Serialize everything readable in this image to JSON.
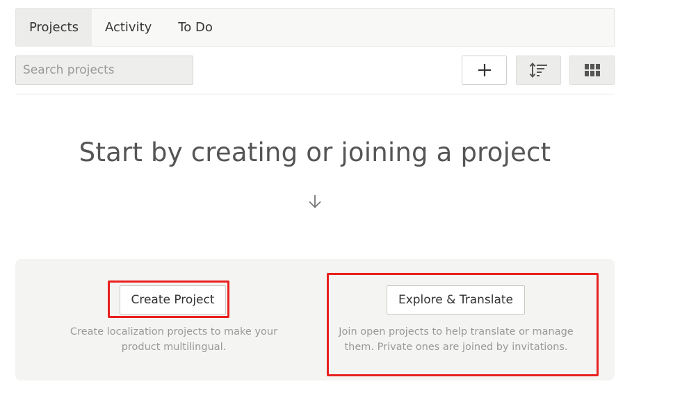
{
  "tabs": [
    {
      "label": "Projects",
      "active": true
    },
    {
      "label": "Activity",
      "active": false
    },
    {
      "label": "To Do",
      "active": false
    }
  ],
  "search": {
    "placeholder": "Search projects",
    "value": ""
  },
  "toolbar": {
    "add_icon": "plus-icon",
    "sort_icon": "sort-icon",
    "view_icon": "grid-view-icon"
  },
  "hero": {
    "title": "Start by creating or joining a project",
    "icon": "arrow-down-icon"
  },
  "options": {
    "create": {
      "button_label": "Create Project",
      "description_line1": "Create localization projects to make your",
      "description_line2": "product multilingual."
    },
    "explore": {
      "button_label": "Explore & Translate",
      "description_line1": "Join open projects to help translate or manage",
      "description_line2": "them. Private ones are joined by invitations."
    }
  },
  "colors": {
    "highlight": "#e8201f",
    "panel_background": "#f4f4f2",
    "active_tab": "#ececea"
  }
}
